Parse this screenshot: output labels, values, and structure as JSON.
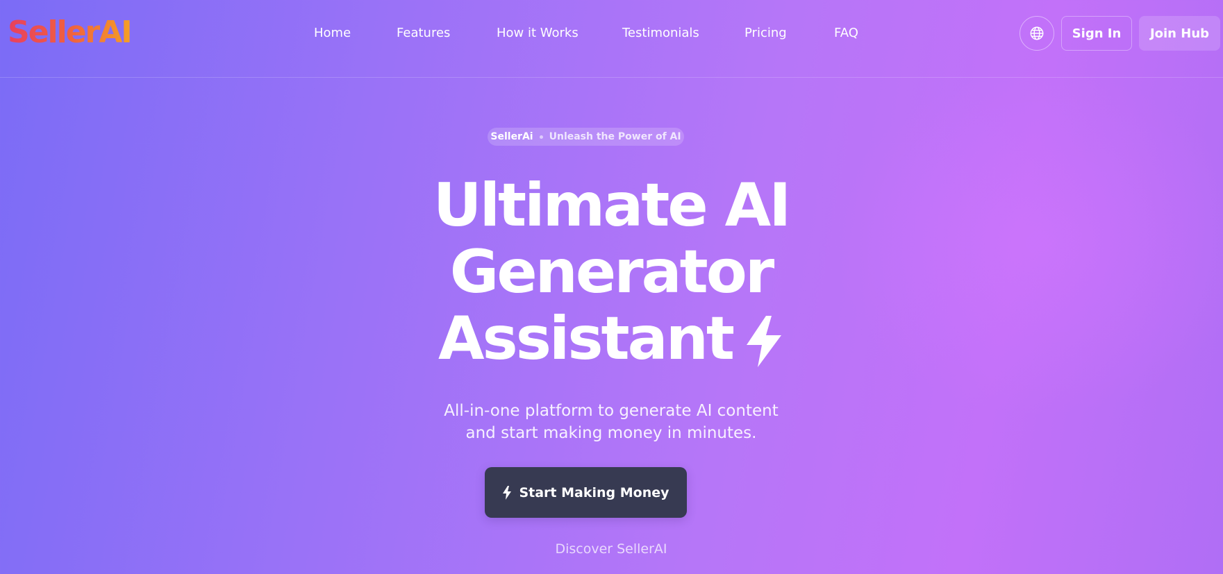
{
  "brand": {
    "logo_text": "SellerAI"
  },
  "nav": {
    "items": [
      {
        "label": "Home"
      },
      {
        "label": "Features"
      },
      {
        "label": "How it Works"
      },
      {
        "label": "Testimonials"
      },
      {
        "label": "Pricing"
      },
      {
        "label": "FAQ"
      }
    ]
  },
  "header_actions": {
    "language_icon": "globe-icon",
    "sign_in_label": "Sign In",
    "join_label": "Join Hub"
  },
  "hero": {
    "badge_brand": "SellerAi",
    "badge_tagline": "Unleash the Power of AI",
    "title_lines": [
      "Ultimate AI",
      "Generator",
      "Assistant"
    ],
    "title_icon": "lightning-bolt-icon",
    "subtitle_lines": [
      "All-in-one platform to generate AI content",
      "and start making money in minutes."
    ],
    "cta_label": "Start Making Money",
    "cta_icon": "lightning-bolt-icon",
    "discover_label": "Discover SellerAI"
  },
  "colors": {
    "logo_gradient": [
      "#e8405f",
      "#f5a024"
    ],
    "cta_background": "#373a52",
    "background_gradient": [
      "#7b6cf6",
      "#c271f9"
    ]
  }
}
